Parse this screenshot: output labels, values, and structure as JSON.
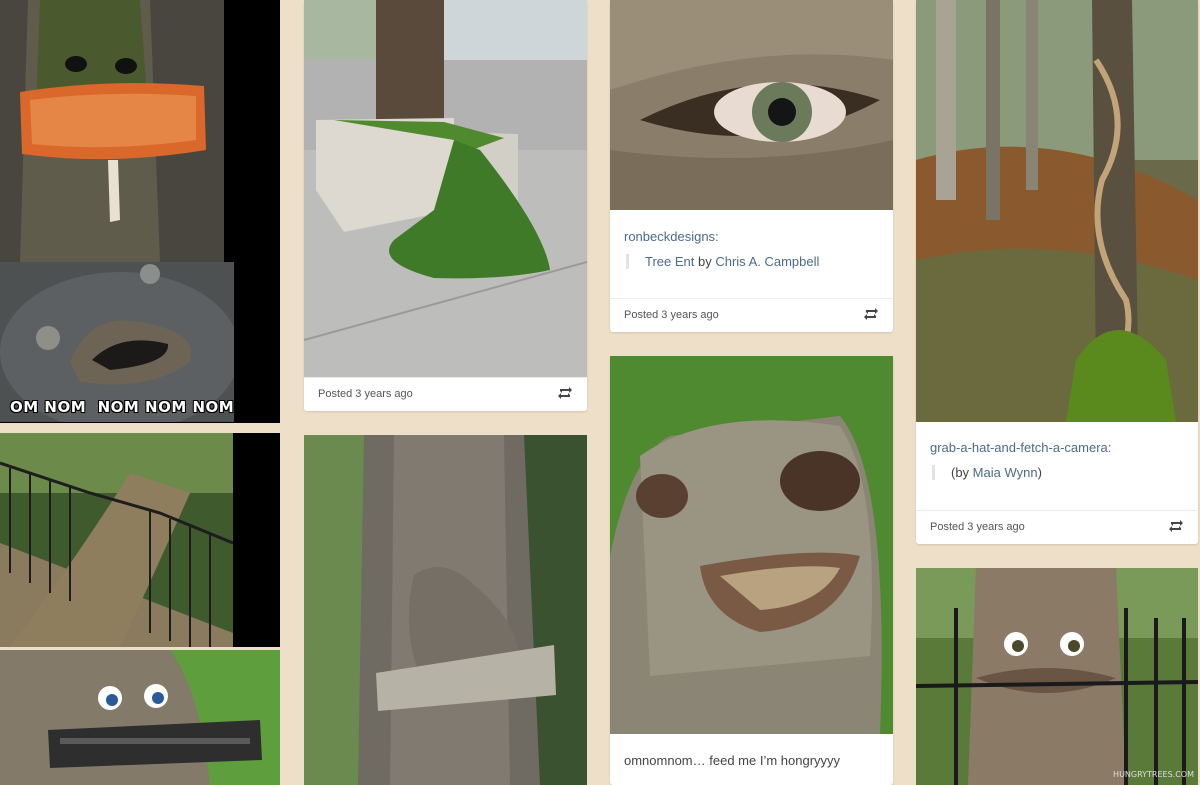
{
  "posts": [
    {
      "id": "meme-collage",
      "meme_caption": "OM NOM  NOM NOM NOM"
    },
    {
      "id": "planter-tree",
      "posted": "Posted 3 years ago",
      "reblog_icon": "reblog-icon"
    },
    {
      "id": "tree-eye",
      "source_user": "ronbeckdesigns:",
      "quote_title": "Tree Ent",
      "quote_by": " by ",
      "quote_author": "Chris A. Campbell",
      "posted": "Posted 3 years ago",
      "reblog_icon": "reblog-icon"
    },
    {
      "id": "ivy-tree",
      "source_user": "grab-a-hat-and-fetch-a-camera:",
      "quote_prefix": "(by ",
      "quote_author": "Maia Wynn",
      "quote_suffix": ")",
      "posted": "Posted 3 years ago",
      "reblog_icon": "reblog-icon"
    },
    {
      "id": "tree-mouth",
      "caption": "omnomnom… feed me I’m hongryyyy"
    },
    {
      "id": "fence-tree",
      "watermark": "HUNGRYTREES.COM"
    }
  ],
  "colors": {
    "background": "#eedfc9",
    "link": "#4b6b8c"
  }
}
